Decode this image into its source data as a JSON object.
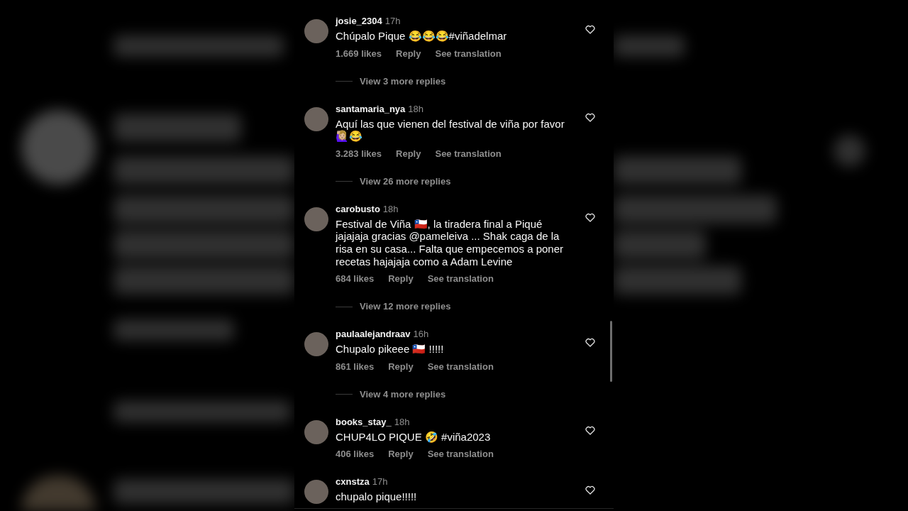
{
  "comments": [
    {
      "username": "josie_2304",
      "time": "17h",
      "text": "Chúpalo Pique 😂😂😂#viñadelmar",
      "likes": "1.669 likes",
      "reply": "Reply",
      "translate": "See translation",
      "view_replies": "View 3 more replies"
    },
    {
      "username": "santamaria_nya",
      "time": "18h",
      "text": "Aquí las que vienen del festival de viña por favor 🙋🏼‍♀️😂",
      "likes": "3.283 likes",
      "reply": "Reply",
      "translate": "See translation",
      "view_replies": "View 26 more replies"
    },
    {
      "username": "carobusto",
      "time": "18h",
      "text": "Festival de Viña 🇨🇱, la tiradera final a Piqué jajajaja gracias @pameleiva ... Shak caga de la risa en su casa... Falta que empecemos a poner recetas hajajaja como a Adam Levine",
      "likes": "684 likes",
      "reply": "Reply",
      "translate": "See translation",
      "view_replies": "View 12 more replies"
    },
    {
      "username": "paulaalejandraav",
      "time": "16h",
      "text": "Chupalo pikeee 🇨🇱 !!!!!",
      "likes": "861 likes",
      "reply": "Reply",
      "translate": "See translation",
      "view_replies": "View 4 more replies"
    },
    {
      "username": "books_stay_",
      "time": "18h",
      "text": "CHUP4LO PIQUE 🤣 #viña2023",
      "likes": "406 likes",
      "reply": "Reply",
      "translate": "See translation"
    },
    {
      "username": "cxnstza",
      "time": "17h",
      "text": "chupalo pique!!!!!"
    }
  ]
}
